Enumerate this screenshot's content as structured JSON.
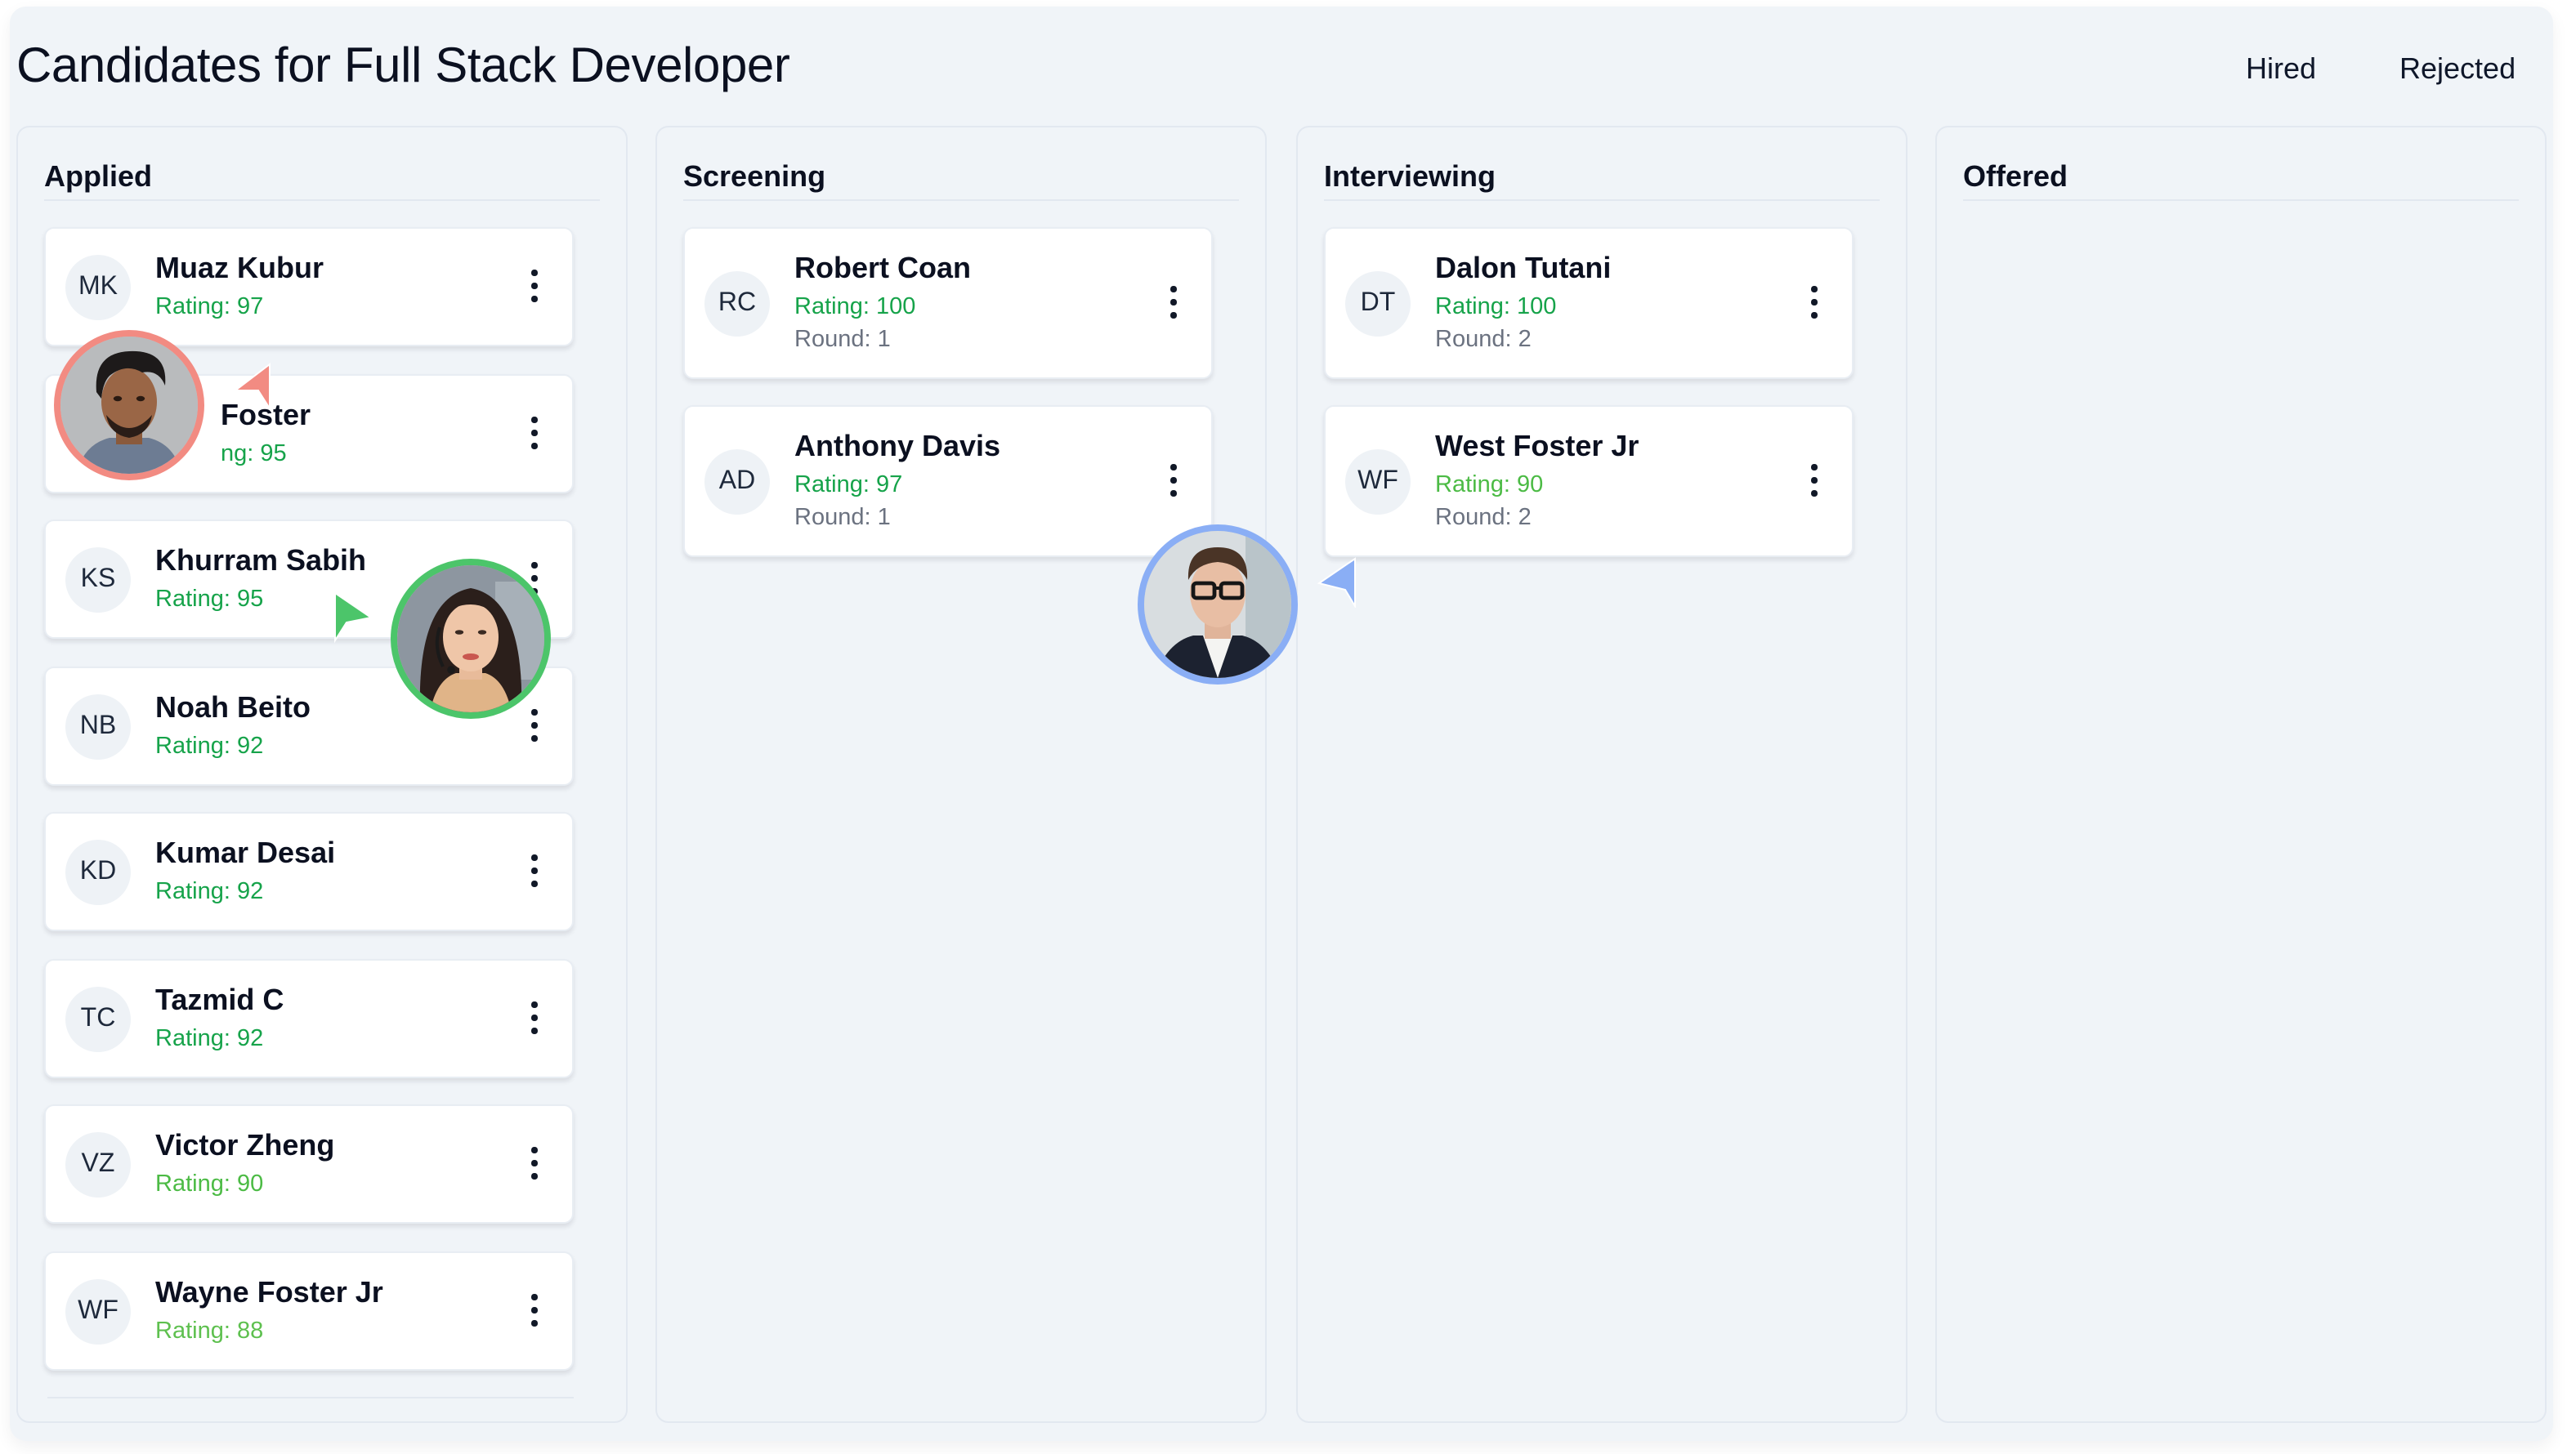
{
  "header": {
    "title": "Candidates for Full Stack Developer",
    "links": [
      {
        "label": "Hired"
      },
      {
        "label": "Rejected"
      }
    ]
  },
  "colors": {
    "rating_high": "#16a34a",
    "rating_mid": "#4cbb45",
    "round_text": "#6b7280",
    "cursor_red": "#f28b82",
    "cursor_green": "#4cc56a",
    "cursor_blue": "#8aaef5"
  },
  "columns": [
    {
      "title": "Applied",
      "cards": [
        {
          "initials": "MK",
          "name": "Muaz Kubur",
          "rating": "Rating: 97"
        },
        {
          "initials": "",
          "name": "Foster",
          "rating": "ng: 95"
        },
        {
          "initials": "KS",
          "name": "Khurram Sabih",
          "rating": "Rating: 95"
        },
        {
          "initials": "NB",
          "name": "Noah Beito",
          "rating": "Rating: 92"
        },
        {
          "initials": "KD",
          "name": "Kumar Desai",
          "rating": "Rating: 92"
        },
        {
          "initials": "TC",
          "name": "Tazmid C",
          "rating": "Rating: 92"
        },
        {
          "initials": "VZ",
          "name": "Victor Zheng",
          "rating": "Rating: 90"
        },
        {
          "initials": "WF",
          "name": "Wayne Foster Jr",
          "rating": "Rating: 88"
        }
      ]
    },
    {
      "title": "Screening",
      "cards": [
        {
          "initials": "RC",
          "name": "Robert Coan",
          "rating": "Rating: 100",
          "round": "Round: 1"
        },
        {
          "initials": "AD",
          "name": "Anthony Davis",
          "rating": "Rating: 97",
          "round": "Round: 1"
        }
      ]
    },
    {
      "title": "Interviewing",
      "cards": [
        {
          "initials": "DT",
          "name": "Dalon Tutani",
          "rating": "Rating: 100",
          "round": "Round: 2"
        },
        {
          "initials": "WF",
          "name": "West Foster Jr",
          "rating": "Rating: 90",
          "round": "Round: 2"
        }
      ]
    },
    {
      "title": "Offered",
      "cards": []
    }
  ],
  "collaborators": [
    {
      "name": "collaborator-red",
      "color": "#f28b82"
    },
    {
      "name": "collaborator-green",
      "color": "#4cc56a"
    },
    {
      "name": "collaborator-blue",
      "color": "#8aaef5"
    }
  ]
}
